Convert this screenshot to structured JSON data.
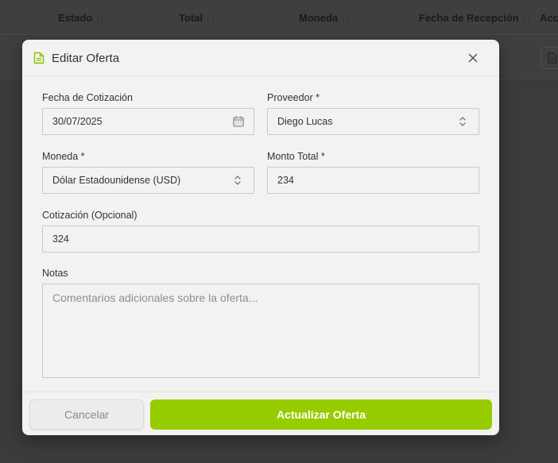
{
  "table": {
    "headers": [
      {
        "label": "Estado",
        "sort": "↑↓"
      },
      {
        "label": "Total",
        "sort": "↑↓"
      },
      {
        "label": "Moneda",
        "sort": "↑↓"
      },
      {
        "label": "Fecha de Recepción",
        "sort": "↑↓"
      },
      {
        "label": "Acc",
        "sort": ""
      }
    ]
  },
  "modal": {
    "title": "Editar Oferta",
    "fields": {
      "fecha_cotizacion": {
        "label": "Fecha de Cotización",
        "value": "30/07/2025"
      },
      "proveedor": {
        "label": "Proveedor *",
        "value": "Diego Lucas"
      },
      "moneda": {
        "label": "Moneda *",
        "value": "Dólar Estadounidense (USD)"
      },
      "monto_total": {
        "label": "Monto Total *",
        "value": "234"
      },
      "cotizacion": {
        "label": "Cotización (Opcional)",
        "value": "324"
      },
      "notas": {
        "label": "Notas",
        "placeholder": "Comentarios adicionales sobre la oferta..."
      }
    },
    "cancel_label": "Cancelar",
    "submit_label": "Actualizar Oferta"
  },
  "colors": {
    "accent": "#96cc00",
    "overlay": "#3b3b3b",
    "modal_bg": "#f2f2f0"
  },
  "icons": {
    "header_icon": "document-icon",
    "close": "close-icon",
    "date": "calendar-icon",
    "select": "chevron-updown-icon"
  }
}
